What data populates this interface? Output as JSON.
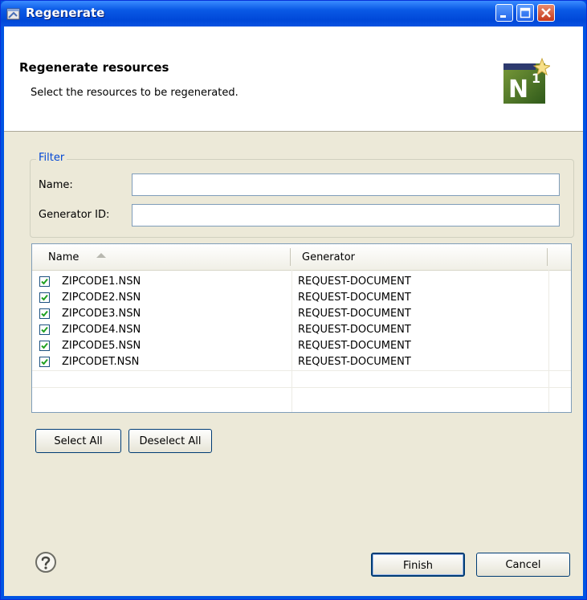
{
  "window": {
    "title": "Regenerate",
    "controls": {
      "minimize": "minimize",
      "maximize": "maximize",
      "close": "close"
    }
  },
  "banner": {
    "title": "Regenerate resources",
    "description": "Select the resources to be regenerated.",
    "logo_text": "N",
    "logo_superscript": "1"
  },
  "filter": {
    "legend": "Filter",
    "name_label": "Name:",
    "name_value": "",
    "generator_label": "Generator ID:",
    "generator_value": ""
  },
  "table": {
    "columns": [
      {
        "label": "Name",
        "sort": "ascending"
      },
      {
        "label": "Generator"
      }
    ],
    "rows": [
      {
        "checked": true,
        "name": "ZIPCODE1.NSN",
        "generator": "REQUEST-DOCUMENT"
      },
      {
        "checked": true,
        "name": "ZIPCODE2.NSN",
        "generator": "REQUEST-DOCUMENT"
      },
      {
        "checked": true,
        "name": "ZIPCODE3.NSN",
        "generator": "REQUEST-DOCUMENT"
      },
      {
        "checked": true,
        "name": "ZIPCODE4.NSN",
        "generator": "REQUEST-DOCUMENT"
      },
      {
        "checked": true,
        "name": "ZIPCODE5.NSN",
        "generator": "REQUEST-DOCUMENT"
      },
      {
        "checked": true,
        "name": "ZIPCODET.NSN",
        "generator": "REQUEST-DOCUMENT"
      }
    ]
  },
  "buttons": {
    "select_all": "Select All",
    "deselect_all": "Deselect All",
    "finish": "Finish",
    "cancel": "Cancel"
  },
  "icons": {
    "help": "help-icon",
    "logo": "n1-logo-icon",
    "app": "window-app-icon"
  },
  "colors": {
    "titlebar": "#0054e3",
    "dialog_background": "#ece9d8",
    "group_legend": "#0046d5",
    "checkbox_check": "#21a121"
  }
}
